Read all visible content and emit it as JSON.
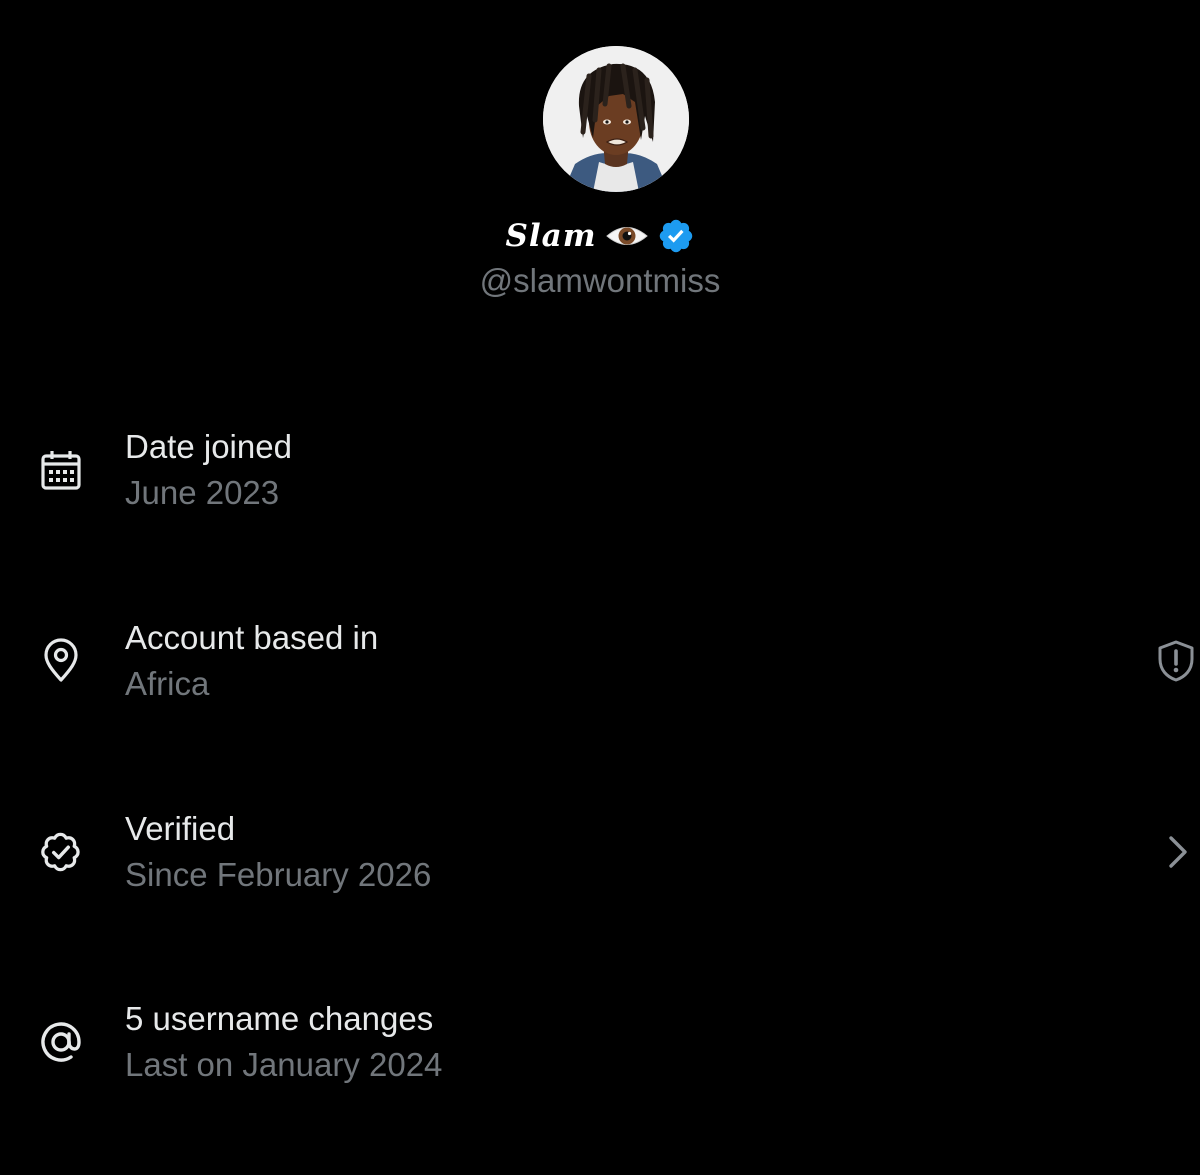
{
  "profile": {
    "display_name": "Slam",
    "handle": "@slamwontmiss",
    "avatar_icon": "avatar-portrait",
    "emoji_icon": "eye-emoji",
    "badge_icon": "verified-badge-icon",
    "badge_color": "#1d9bf0"
  },
  "details": [
    {
      "icon": "calendar-icon",
      "title": "Date joined",
      "subtitle": "June 2023"
    },
    {
      "icon": "location-pin-icon",
      "title": "Account based in",
      "subtitle": "Africa",
      "trailing_icon": "shield-alert-icon"
    },
    {
      "icon": "verified-outline-icon",
      "title": "Verified",
      "subtitle": "Since February 2026",
      "trailing_icon": "chevron-right-icon"
    },
    {
      "icon": "at-sign-icon",
      "title": "5 username changes",
      "subtitle": "Last on January 2024"
    }
  ],
  "colors": {
    "background": "#000000",
    "primary_text": "#e7e9ea",
    "secondary_text": "#71767b",
    "accent": "#1d9bf0"
  }
}
